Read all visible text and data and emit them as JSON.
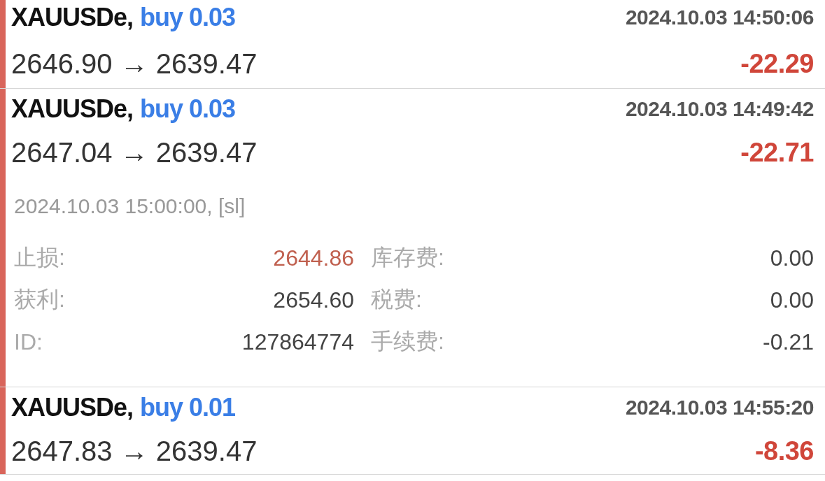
{
  "trades": [
    {
      "symbol": "XAUUSDe,",
      "order": "buy 0.03",
      "time": "2024.10.03 14:50:06",
      "prices": "2646.90 → 2639.47",
      "profit": "-22.29",
      "expanded": false
    },
    {
      "symbol": "XAUUSDe,",
      "order": "buy 0.03",
      "time": "2024.10.03 14:49:42",
      "prices": "2647.04 → 2639.47",
      "profit": "-22.71",
      "expanded": true,
      "details": {
        "comment": "2024.10.03 15:00:00, [sl]",
        "fields": [
          {
            "label": "止损:",
            "value": "2644.86",
            "highlighted": true
          },
          {
            "label": "库存费:",
            "value": "0.00",
            "highlighted": false
          },
          {
            "label": "获利:",
            "value": "2654.60",
            "highlighted": false
          },
          {
            "label": "税费:",
            "value": "0.00",
            "highlighted": false
          },
          {
            "label": "ID:",
            "value": "127864774",
            "highlighted": false
          },
          {
            "label": "手续费:",
            "value": "-0.21",
            "highlighted": false
          }
        ]
      }
    },
    {
      "symbol": "XAUUSDe,",
      "order": "buy 0.01",
      "time": "2024.10.03 14:55:20",
      "prices": "2647.83 → 2639.47",
      "profit": "-8.36",
      "expanded": false
    }
  ]
}
